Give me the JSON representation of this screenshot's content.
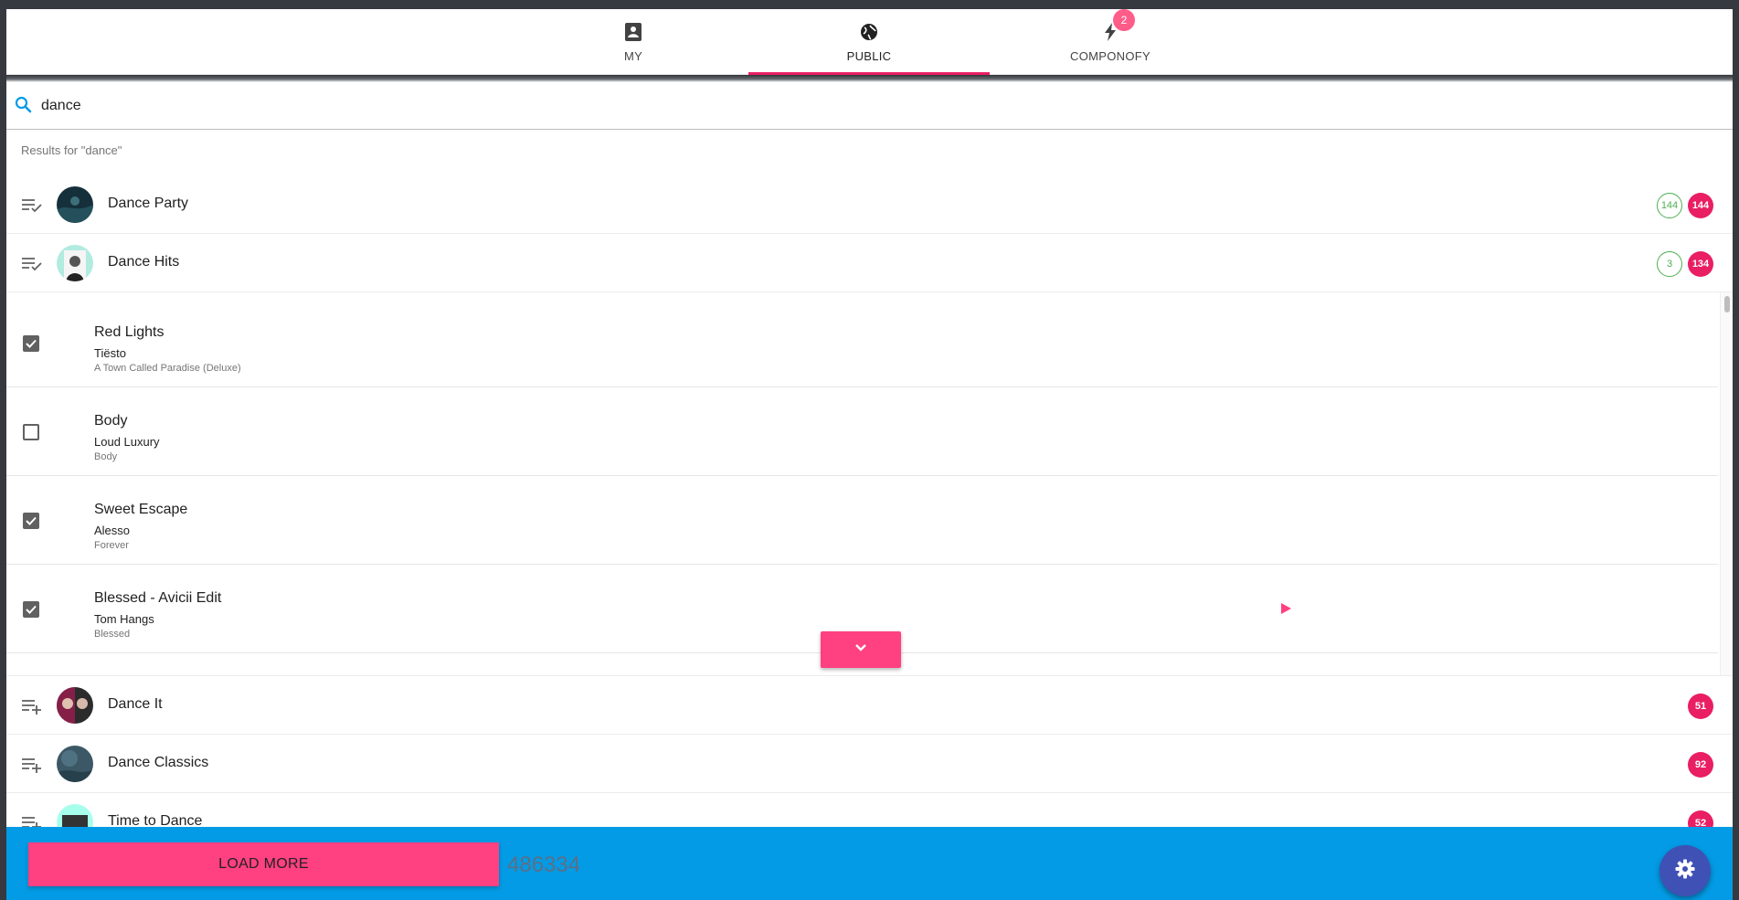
{
  "tabs": [
    {
      "label": "MY",
      "icon": "contact-icon",
      "active": false
    },
    {
      "label": "PUBLIC",
      "icon": "globe-icon",
      "active": true
    },
    {
      "label": "COMPONOFY",
      "icon": "flash-icon",
      "active": false,
      "badge": "2"
    }
  ],
  "search": {
    "value": "dance",
    "results_label": "Results for \"dance\""
  },
  "playlists_top": [
    {
      "title": "Dance Party",
      "action_icon": "playlist-check-icon",
      "selected_count": "144",
      "total_count": "144"
    },
    {
      "title": "Dance Hits",
      "action_icon": "playlist-check-icon",
      "selected_count": "3",
      "total_count": "134"
    }
  ],
  "tracks": [
    {
      "name": "Red Lights",
      "artist": "Tiësto",
      "album": "A Town Called Paradise (Deluxe)",
      "checked": true
    },
    {
      "name": "Body",
      "artist": "Loud Luxury",
      "album": "Body",
      "checked": false
    },
    {
      "name": "Sweet Escape",
      "artist": "Alesso",
      "album": "Forever",
      "checked": true
    },
    {
      "name": "Blessed - Avicii Edit",
      "artist": "Tom Hangs",
      "album": "Blessed",
      "checked": true
    }
  ],
  "playlists_bottom": [
    {
      "title": "Dance It",
      "action_icon": "playlist-add-icon",
      "total_count": "51"
    },
    {
      "title": "Dance Classics",
      "action_icon": "playlist-add-icon",
      "total_count": "92"
    },
    {
      "title": "Time to Dance",
      "action_icon": "playlist-add-icon",
      "total_count": "52"
    }
  ],
  "footer": {
    "load_more_label": "LOAD MORE",
    "total": "486334",
    "settings_icon": "gear-icon"
  },
  "colors": {
    "accent": "#e91e63",
    "pink_button": "#ff4081",
    "footer_bg": "#039be5",
    "fab": "#3f51b5",
    "count_outline": "#4caf50"
  }
}
